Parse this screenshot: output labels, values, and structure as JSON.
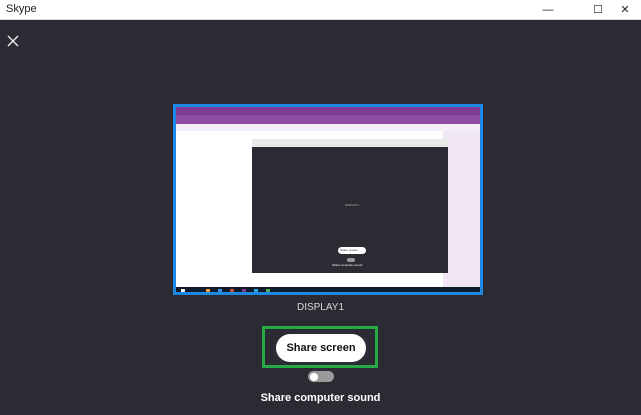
{
  "window": {
    "title": "Skype"
  },
  "window_controls": {
    "minimize": "—",
    "maximize": "☐",
    "close": "✕"
  },
  "preview": {
    "display_name": "DISPLAY1",
    "inner_label_a": "Share screen",
    "inner_label_b": "Share computer sound",
    "inner_center": "DISPLAY1"
  },
  "share_button": {
    "label": "Share screen"
  },
  "sound_toggle": {
    "label": "Share computer sound",
    "enabled": false
  },
  "colors": {
    "background": "#2b2c33",
    "preview_border": "#1e88e5",
    "highlight_border": "#27a844",
    "onenote_purple": "#7b3c91"
  },
  "icons": {
    "close_overlay": "close-icon"
  }
}
